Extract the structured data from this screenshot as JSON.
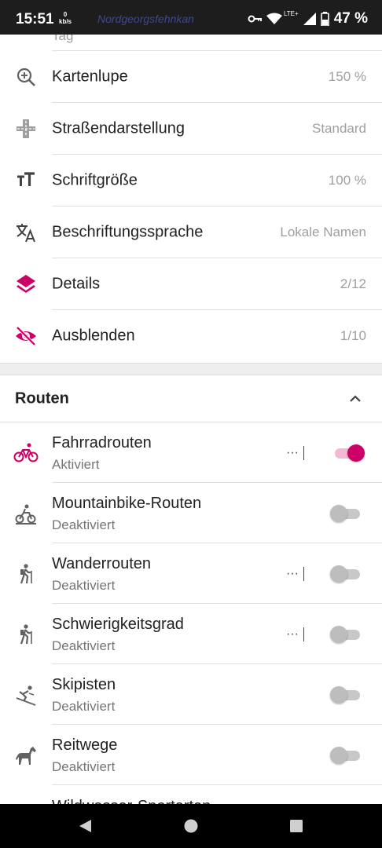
{
  "status_bar": {
    "time": "15:51",
    "speed_value": "0",
    "speed_unit": "kb/s",
    "map_label": "Nordgeorgsfehnkan",
    "network": "LTE+",
    "battery": "47 %"
  },
  "top_partial": "Tag",
  "settings": [
    {
      "label": "Kartenlupe",
      "value": "150 %",
      "icon": "magnifier-plus-icon"
    },
    {
      "label": "Straßendarstellung",
      "value": "Standard",
      "icon": "road-icon"
    },
    {
      "label": "Schriftgröße",
      "value": "100 %",
      "icon": "text-size-icon"
    },
    {
      "label": "Beschriftungssprache",
      "value": "Lokale Namen",
      "icon": "translate-icon"
    },
    {
      "label": "Details",
      "value": "2/12",
      "icon": "layers-icon"
    },
    {
      "label": "Ausblenden",
      "value": "1/10",
      "icon": "eye-off-icon"
    }
  ],
  "routes_section": {
    "title": "Routen"
  },
  "routes": [
    {
      "label": "Fahrradrouten",
      "status": "Aktiviert",
      "icon": "bicycle-icon",
      "on": true,
      "more": "···"
    },
    {
      "label": "Mountainbike-Routen",
      "status": "Deaktiviert",
      "icon": "mountainbike-icon",
      "on": false
    },
    {
      "label": "Wanderrouten",
      "status": "Deaktiviert",
      "icon": "hiker-icon",
      "on": false,
      "more": "···"
    },
    {
      "label": "Schwierigkeitsgrad",
      "status": "Deaktiviert",
      "icon": "hiker-icon",
      "on": false,
      "more": "···"
    },
    {
      "label": "Skipisten",
      "status": "Deaktiviert",
      "icon": "skier-icon",
      "on": false
    },
    {
      "label": "Reitwege",
      "status": "Deaktiviert",
      "icon": "horse-icon",
      "on": false
    }
  ],
  "bottom_partial": "Wildwasser-Sportarten",
  "colors": {
    "accent": "#cc0066",
    "icon_gray": "#616161"
  }
}
